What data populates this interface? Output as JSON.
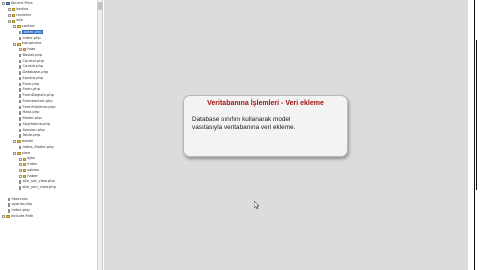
{
  "tree": [
    {
      "label": "Source Files",
      "depth": 0,
      "kind": "project"
    },
    {
      "label": "kedivo",
      "depth": 1,
      "kind": "folder"
    },
    {
      "label": "resimler",
      "depth": 1,
      "kind": "folder"
    },
    {
      "label": "site",
      "depth": 1,
      "kind": "folder"
    },
    {
      "label": "control",
      "depth": 2,
      "kind": "folder"
    },
    {
      "label": "Islem.php",
      "depth": 3,
      "kind": "file",
      "selected": true
    },
    {
      "label": "index.php",
      "depth": 3,
      "kind": "file"
    },
    {
      "label": "kutuphane",
      "depth": 2,
      "kind": "folder"
    },
    {
      "label": "haar",
      "depth": 3,
      "kind": "folder"
    },
    {
      "label": "Baslat.php",
      "depth": 3,
      "kind": "file"
    },
    {
      "label": "Control.php",
      "depth": 3,
      "kind": "file"
    },
    {
      "label": "Cookie.php",
      "depth": 3,
      "kind": "file"
    },
    {
      "label": "Database.php",
      "depth": 3,
      "kind": "file"
    },
    {
      "label": "Eposta.php",
      "depth": 3,
      "kind": "file"
    },
    {
      "label": "Fonk.php",
      "depth": 3,
      "kind": "file"
    },
    {
      "label": "Form.php",
      "depth": 3,
      "kind": "file"
    },
    {
      "label": "FormDegistir.php",
      "depth": 3,
      "kind": "file"
    },
    {
      "label": "Formkontrol.php",
      "depth": 3,
      "kind": "file"
    },
    {
      "label": "FormYukleme.php",
      "depth": 3,
      "kind": "file"
    },
    {
      "label": "Hata.php",
      "depth": 3,
      "kind": "file"
    },
    {
      "label": "Model.php",
      "depth": 3,
      "kind": "file"
    },
    {
      "label": "Sayfalama.php",
      "depth": 3,
      "kind": "file"
    },
    {
      "label": "Session.php",
      "depth": 3,
      "kind": "file"
    },
    {
      "label": "Table.php",
      "depth": 3,
      "kind": "file"
    },
    {
      "label": "model",
      "depth": 2,
      "kind": "folder"
    },
    {
      "label": "Index_Model.php",
      "depth": 3,
      "kind": "file"
    },
    {
      "label": "view",
      "depth": 2,
      "kind": "folder"
    },
    {
      "label": "ajax",
      "depth": 3,
      "kind": "folder"
    },
    {
      "label": "index",
      "depth": 3,
      "kind": "folder"
    },
    {
      "label": "sablon",
      "depth": 3,
      "kind": "folder"
    },
    {
      "label": "haber",
      "depth": 3,
      "kind": "folder"
    },
    {
      "label": "site_ust_view.php",
      "depth": 3,
      "kind": "file"
    },
    {
      "label": "site_yan_view.php",
      "depth": 3,
      "kind": "file"
    },
    {
      "label": "",
      "depth": 1,
      "kind": "spacer"
    },
    {
      "label": "htaccess",
      "depth": 1,
      "kind": "file"
    },
    {
      "label": "ayarlar.php",
      "depth": 1,
      "kind": "file"
    },
    {
      "label": "index.php",
      "depth": 1,
      "kind": "file"
    },
    {
      "label": "Include Path",
      "depth": 0,
      "kind": "folder"
    }
  ],
  "callout": {
    "title": "Veritabanına İşlemleri - Veri ekleme",
    "line1": "Database sınıfını kullanarak model",
    "line2": "vasıtasıyla veritabanına veri ekleme."
  },
  "colors": {
    "editor_bg": "#dcdcdc",
    "callout_title": "#a01414",
    "selection": "#3169c6"
  }
}
